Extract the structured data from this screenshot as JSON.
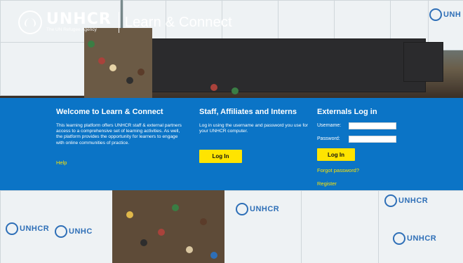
{
  "header": {
    "org_name": "UNHCR",
    "org_tagline": "The UN Refugee Agency",
    "product_name": "Learn & Connect"
  },
  "tarp_labels": {
    "top_right": "UNH",
    "bottom_1": "UNHCR",
    "bottom_2": "UNHC",
    "bottom_3": "UNHCR",
    "bottom_4": "UNHCR",
    "bottom_5": "UNHCR"
  },
  "welcome": {
    "title": "Welcome to Learn & Connect",
    "body": "This learning platform offers UNHCR staff & external partners access to a comprehensive set of learning activities. As well, the platform provides the opportunity for learners to engage with online communities of practice.",
    "help_link": "Help"
  },
  "staff": {
    "title": "Staff, Affiliates and Interns",
    "body": "Log in using the username and password you use for your UNHCR computer.",
    "login_button": "Log In"
  },
  "externals": {
    "title": "Externals Log in",
    "username_label": "Username:",
    "username_value": "",
    "password_label": "Password:",
    "password_value": "",
    "login_button": "Log In",
    "forgot_link": "Forgot password?",
    "register_link": "Register"
  },
  "colors": {
    "band_blue": "#0b74c6",
    "accent_yellow": "#ffe400",
    "brand_blue": "#2e6fb7"
  }
}
